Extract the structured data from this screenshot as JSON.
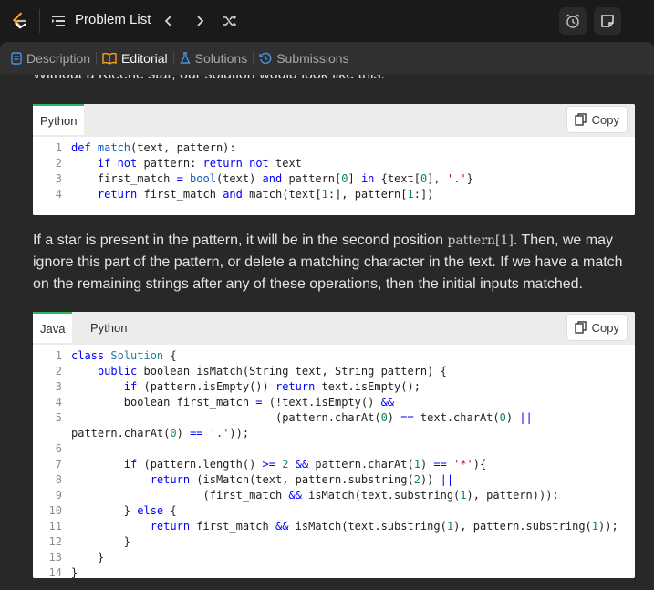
{
  "topbar": {
    "title": "Problem List"
  },
  "tabs": [
    {
      "label": "Description",
      "icon": "description-icon"
    },
    {
      "label": "Editorial",
      "icon": "book-icon"
    },
    {
      "label": "Solutions",
      "icon": "flask-icon"
    },
    {
      "label": "Submissions",
      "icon": "history-icon"
    }
  ],
  "text": {
    "cut_line": "Without a Kleene star, our solution would look like this:",
    "p1_a": "If a star is present in the pattern, it will be in the second position",
    "p1_math": "pattern[1]",
    "p1_b": ". Then, we may ignore this part of the pattern, or delete a matching character in the text. If we have a match on the remaining strings after any of these operations, then the initial inputs matched."
  },
  "code1": {
    "tabs": [
      "Python"
    ],
    "copy_label": "Copy",
    "lines": [
      {
        "n": "1",
        "tokens": [
          [
            "kw",
            "def "
          ],
          [
            "fn",
            "match"
          ],
          [
            "",
            "(text, pattern):"
          ]
        ]
      },
      {
        "n": "2",
        "tokens": [
          [
            "",
            "    "
          ],
          [
            "kw",
            "if not"
          ],
          [
            "",
            " pattern: "
          ],
          [
            "kw",
            "return not"
          ],
          [
            "",
            " text"
          ]
        ]
      },
      {
        "n": "3",
        "tokens": [
          [
            "",
            "    first_match "
          ],
          [
            "kw",
            "="
          ],
          [
            " ",
            ""
          ],
          [
            "fn",
            " bool"
          ],
          [
            "",
            "(text) "
          ],
          [
            "kw",
            "and"
          ],
          [
            "",
            " pattern["
          ],
          [
            "num",
            "0"
          ],
          [
            "",
            "] "
          ],
          [
            "kw",
            "in"
          ],
          [
            "",
            " {text["
          ],
          [
            "num",
            "0"
          ],
          [
            "",
            "], "
          ],
          [
            "str",
            "'.'"
          ],
          [
            "",
            "}"
          ]
        ]
      },
      {
        "n": "4",
        "tokens": [
          [
            "",
            "    "
          ],
          [
            "kw",
            "return"
          ],
          [
            "",
            " first_match "
          ],
          [
            "kw",
            "and"
          ],
          [
            "",
            " match(text["
          ],
          [
            "num",
            "1"
          ],
          [
            "",
            ":], pattern["
          ],
          [
            "num",
            "1"
          ],
          [
            "",
            ":])"
          ]
        ]
      }
    ]
  },
  "code2": {
    "tabs": [
      "Java",
      "Python"
    ],
    "copy_label": "Copy",
    "lines": [
      {
        "n": "1",
        "tokens": [
          [
            "kw",
            "class "
          ],
          [
            "cls",
            "Solution"
          ],
          [
            "",
            " {"
          ]
        ]
      },
      {
        "n": "2",
        "tokens": [
          [
            "",
            "    "
          ],
          [
            "kw",
            "public"
          ],
          [
            "",
            " boolean isMatch(String text, String pattern) {"
          ]
        ]
      },
      {
        "n": "3",
        "tokens": [
          [
            "",
            "        "
          ],
          [
            "kw",
            "if"
          ],
          [
            "",
            " (pattern.isEmpty()) "
          ],
          [
            "kw",
            "return"
          ],
          [
            "",
            " text.isEmpty();"
          ]
        ]
      },
      {
        "n": "4",
        "tokens": [
          [
            "",
            "        boolean first_match "
          ],
          [
            "kw",
            "="
          ],
          [
            "",
            " (!text.isEmpty() "
          ],
          [
            "kw",
            "&&"
          ]
        ]
      },
      {
        "n": "5",
        "tokens": [
          [
            "",
            "                               (pattern.charAt("
          ],
          [
            "num",
            "0"
          ],
          [
            "",
            ") "
          ],
          [
            "kw",
            "=="
          ],
          [
            "",
            " text.charAt("
          ],
          [
            "num",
            "0"
          ],
          [
            "",
            ") "
          ],
          [
            "kw",
            "||"
          ]
        ]
      },
      {
        "n": "",
        "tokens": [
          [
            "",
            "pattern.charAt("
          ],
          [
            "num",
            "0"
          ],
          [
            "",
            ") "
          ],
          [
            "kw",
            "=="
          ],
          [
            " ",
            ""
          ],
          [
            "str",
            " '.'"
          ],
          [
            "",
            "));"
          ]
        ]
      },
      {
        "n": "6",
        "tokens": []
      },
      {
        "n": "7",
        "tokens": [
          [
            "",
            "        "
          ],
          [
            "kw",
            "if"
          ],
          [
            "",
            " (pattern.length() "
          ],
          [
            "kw",
            ">="
          ],
          [
            " ",
            ""
          ],
          [
            "num",
            " 2"
          ],
          [
            "",
            ""
          ],
          [
            "",
            " "
          ],
          [
            "kw",
            "&&"
          ],
          [
            "",
            " pattern.charAt("
          ],
          [
            "num",
            "1"
          ],
          [
            "",
            ") "
          ],
          [
            "kw",
            "=="
          ],
          [
            "",
            " "
          ],
          [
            "str",
            "'*'"
          ],
          [
            "",
            "){"
          ]
        ]
      },
      {
        "n": "8",
        "tokens": [
          [
            "",
            "            "
          ],
          [
            "kw",
            "return"
          ],
          [
            "",
            " (isMatch(text, pattern.substring("
          ],
          [
            "num",
            "2"
          ],
          [
            "",
            ")) "
          ],
          [
            "kw",
            "||"
          ]
        ]
      },
      {
        "n": "9",
        "tokens": [
          [
            "",
            "                    (first_match "
          ],
          [
            "kw",
            "&&"
          ],
          [
            "",
            " isMatch(text.substring("
          ],
          [
            "num",
            "1"
          ],
          [
            "",
            "), pattern)));"
          ]
        ]
      },
      {
        "n": "10",
        "tokens": [
          [
            "",
            "        } "
          ],
          [
            "kw",
            "else"
          ],
          [
            "",
            " {"
          ]
        ]
      },
      {
        "n": "11",
        "tokens": [
          [
            "",
            "            "
          ],
          [
            "kw",
            "return"
          ],
          [
            "",
            " first_match "
          ],
          [
            "kw",
            "&&"
          ],
          [
            "",
            " isMatch(text.substring("
          ],
          [
            "num",
            "1"
          ],
          [
            "",
            "), pattern.substring("
          ],
          [
            "num",
            "1"
          ],
          [
            "",
            "));"
          ]
        ]
      },
      {
        "n": "12",
        "tokens": [
          [
            "",
            "        }"
          ]
        ]
      },
      {
        "n": "13",
        "tokens": [
          [
            "",
            "    }"
          ]
        ]
      },
      {
        "n": "14",
        "tokens": [
          [
            "",
            "}"
          ]
        ]
      }
    ]
  }
}
